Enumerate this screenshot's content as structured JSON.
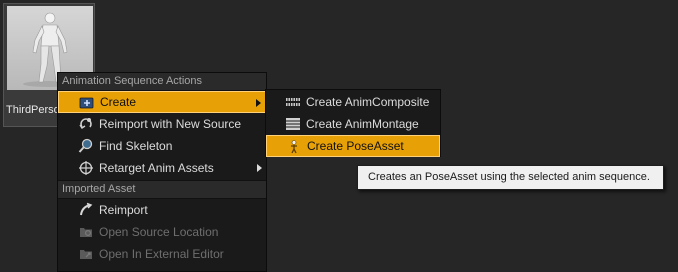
{
  "asset": {
    "name": "ThirdPerson",
    "thumbnail_icon": "mannequin-thumbnail"
  },
  "context_menu": {
    "section_actions": "Animation Sequence Actions",
    "items": [
      {
        "label": "Create",
        "icon": "create-icon",
        "highlighted": true,
        "submenu": true
      },
      {
        "label": "Reimport with New Source",
        "icon": "reimport-new-source-icon"
      },
      {
        "label": "Find Skeleton",
        "icon": "find-skeleton-icon"
      },
      {
        "label": "Retarget Anim Assets",
        "icon": "retarget-icon",
        "submenu": true
      }
    ],
    "section_imported": "Imported Asset",
    "imported_items": [
      {
        "label": "Reimport",
        "icon": "reimport-icon"
      },
      {
        "label": "Open Source Location",
        "icon": "open-source-location-icon",
        "disabled": true
      },
      {
        "label": "Open In External Editor",
        "icon": "open-external-editor-icon",
        "disabled": true
      }
    ]
  },
  "create_submenu": {
    "items": [
      {
        "label": "Create AnimComposite",
        "icon": "anim-composite-icon"
      },
      {
        "label": "Create AnimMontage",
        "icon": "anim-montage-icon"
      },
      {
        "label": "Create PoseAsset",
        "icon": "pose-asset-icon",
        "highlighted": true
      }
    ]
  },
  "tooltip": {
    "text": "Creates an PoseAsset using the selected anim sequence."
  },
  "colors": {
    "highlight": "#e8a007",
    "menu_background": "#1a1a1a",
    "tooltip_background": "#f0f0f0"
  }
}
